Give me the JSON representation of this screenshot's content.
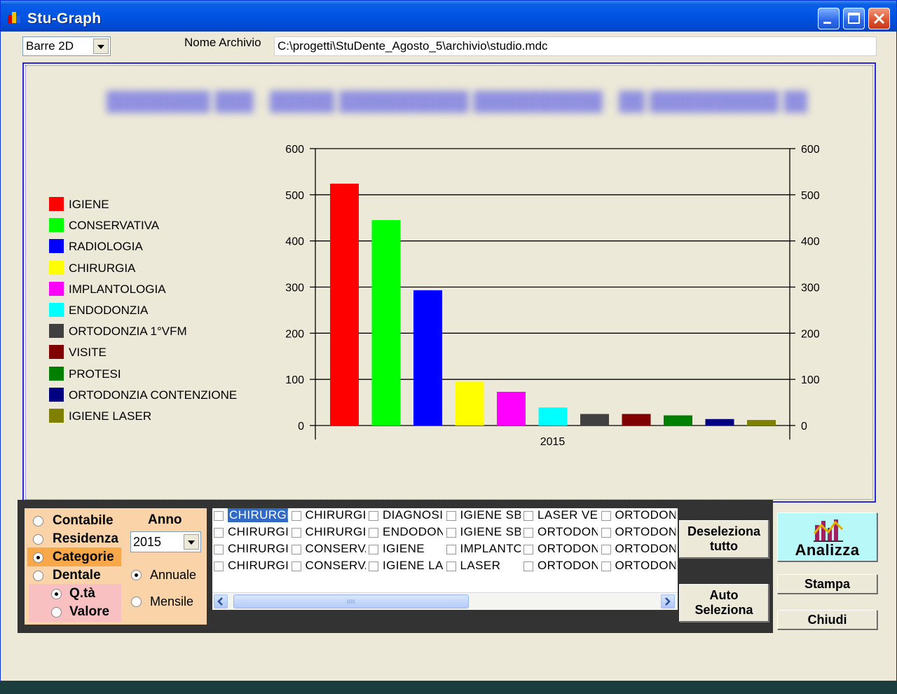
{
  "window": {
    "title": "Stu-Graph"
  },
  "toolbar": {
    "chart_type": "Barre 2D",
    "archive_label": "Nome Archivio",
    "archive_path": "C:\\progetti\\StuDente_Agosto_5\\archivio\\studio.mdc"
  },
  "colors": {
    "titlebar": "#0054e3",
    "chart_border": "#2a2ad6",
    "options_panel": "#fbd3a8",
    "categorie_highlight": "#f8a848",
    "qta_panel": "#f8c0c0",
    "analizza_button": "#b8f8f8"
  },
  "chart_data": {
    "type": "bar",
    "categories": [
      "2015"
    ],
    "ylim": [
      0,
      600
    ],
    "yticks": [
      "0",
      "100",
      "200",
      "300",
      "400",
      "500",
      "600"
    ],
    "grid": true,
    "dual_y_axis": true,
    "legend_position": "left",
    "series": [
      {
        "name": "IGIENE",
        "values": [
          524
        ],
        "color": "#ff0000"
      },
      {
        "name": "CONSERVATIVA",
        "values": [
          445
        ],
        "color": "#00ff00"
      },
      {
        "name": "RADIOLOGIA",
        "values": [
          293
        ],
        "color": "#0000ff"
      },
      {
        "name": "CHIRURGIA",
        "values": [
          95
        ],
        "color": "#ffff00"
      },
      {
        "name": "IMPLANTOLOGIA",
        "values": [
          73
        ],
        "color": "#ff00ff"
      },
      {
        "name": "ENDODONZIA",
        "values": [
          39
        ],
        "color": "#00ffff"
      },
      {
        "name": "ORTODONZIA 1°VFM",
        "values": [
          25
        ],
        "color": "#404040"
      },
      {
        "name": "VISITE",
        "values": [
          25
        ],
        "color": "#800000"
      },
      {
        "name": "PROTESI",
        "values": [
          22
        ],
        "color": "#008000"
      },
      {
        "name": "ORTODONZIA CONTENZIONE",
        "values": [
          14
        ],
        "color": "#000080"
      },
      {
        "name": "IGIENE LASER",
        "values": [
          12
        ],
        "color": "#808000"
      }
    ]
  },
  "options": {
    "radios": [
      {
        "label": "Contabile",
        "checked": false
      },
      {
        "label": "Residenza",
        "checked": false
      },
      {
        "label": "Categorie",
        "checked": true
      },
      {
        "label": "Dentale",
        "checked": false
      }
    ],
    "sub_radios": [
      {
        "label": "Q.tà",
        "checked": true
      },
      {
        "label": "Valore",
        "checked": false
      }
    ],
    "year_label": "Anno",
    "year_value": "2015",
    "period_radios": [
      {
        "label": "Annuale",
        "checked": true
      },
      {
        "label": "Mensile",
        "checked": false
      }
    ]
  },
  "checklist": {
    "columns": [
      [
        "CHIRURGIA",
        "CHIRURGIA",
        "CHIRURGIA",
        "CHIRURGIA"
      ],
      [
        "CHIRURGIA",
        "CHIRURGIA",
        "CONSERVATIVA",
        "CONSERVATIVA"
      ],
      [
        "DIAGNOSI",
        "ENDODONZIA",
        "IGIENE",
        "IGIENE LASER"
      ],
      [
        "IGIENE SBIANCANTE",
        "IGIENE SBIANCANTE",
        "IMPLANTOLOGIA",
        "LASER"
      ],
      [
        "LASER VET",
        "ORTODONZIA",
        "ORTODONZIA",
        "ORTODONZIA"
      ],
      [
        "ORTODONZIA",
        "ORTODONZIA",
        "ORTODONZIA",
        "ORTODONZIA"
      ]
    ],
    "selected_index": 0
  },
  "buttons": {
    "deseleziona": "Deseleziona tutto",
    "auto_seleziona": "Auto Seleziona",
    "analizza": "Analizza",
    "stampa": "Stampa",
    "chiudi": "Chiudi"
  }
}
